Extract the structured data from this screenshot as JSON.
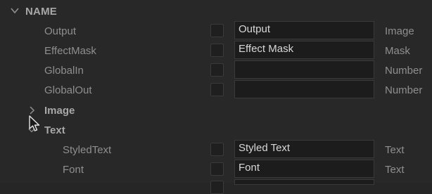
{
  "section": {
    "title": "NAME"
  },
  "inputs": [
    {
      "label": "Output",
      "value": "Output",
      "type": "Image"
    },
    {
      "label": "EffectMask",
      "value": "Effect Mask",
      "type": "Mask"
    },
    {
      "label": "GlobalIn",
      "value": "",
      "type": "Number"
    },
    {
      "label": "GlobalOut",
      "value": "",
      "type": "Number"
    }
  ],
  "groups": [
    {
      "label": "Image"
    },
    {
      "label": "Text"
    }
  ],
  "text_inputs": [
    {
      "label": "StyledText",
      "value": "Styled Text",
      "type": "Text"
    },
    {
      "label": "Font",
      "value": "Font",
      "type": "Text"
    }
  ],
  "colors": {
    "background": "#282828",
    "field_bg": "#1c1c1c",
    "label_text": "#8f8f8f",
    "value_text": "#d8d8d8"
  }
}
